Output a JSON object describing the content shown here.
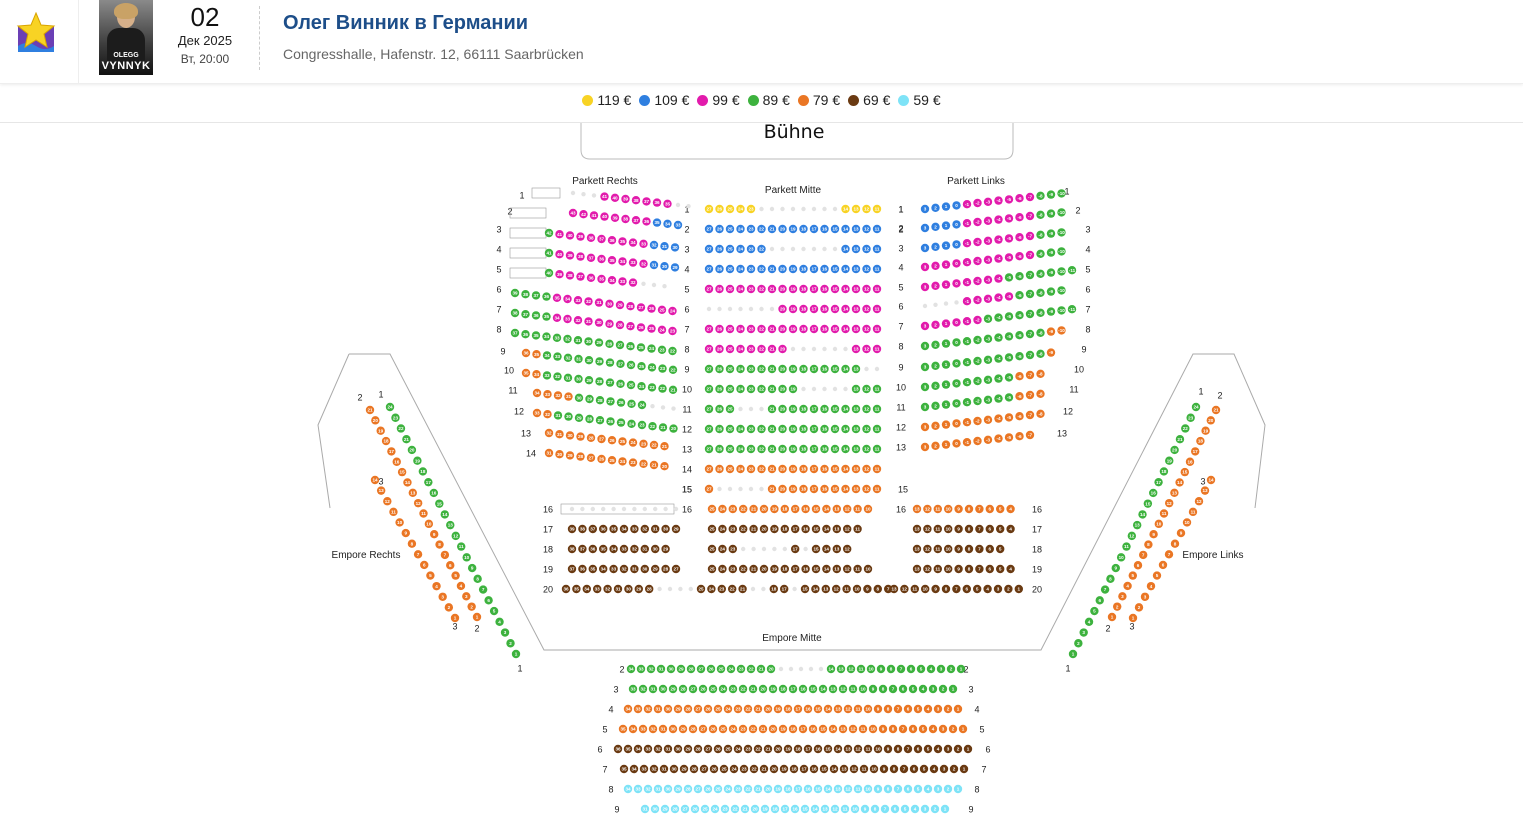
{
  "event": {
    "day": "02",
    "month_year": "Дек 2025",
    "weekday_time": "Вт, 20:00",
    "title": "Олег Винник в Германии",
    "venue": "Congresshalle, Hafenstr. 12, 66111 Saarbrücken",
    "poster_line1": "OLEGG",
    "poster_line2": "VYNNYK"
  },
  "legend": [
    {
      "price": "119 €",
      "color": "#f8d324"
    },
    {
      "price": "109 €",
      "color": "#2f7fe0"
    },
    {
      "price": "99 €",
      "color": "#e21bac"
    },
    {
      "price": "89 €",
      "color": "#3db23e"
    },
    {
      "price": "79 €",
      "color": "#ea7624"
    },
    {
      "price": "69 €",
      "color": "#6a3a12"
    },
    {
      "price": "59 €",
      "color": "#7ee3f7"
    }
  ],
  "hall": {
    "stage_label": "Bühne",
    "sections": {
      "parkett_rechts": "Parkett Rechts",
      "parkett_mitte": "Parkett Mitte",
      "parkett_links": "Parkett Links",
      "empore_rechts": "Empore Rechts",
      "empore_links": "Empore Links",
      "empore_mitte": "Empore Mitte"
    }
  }
}
